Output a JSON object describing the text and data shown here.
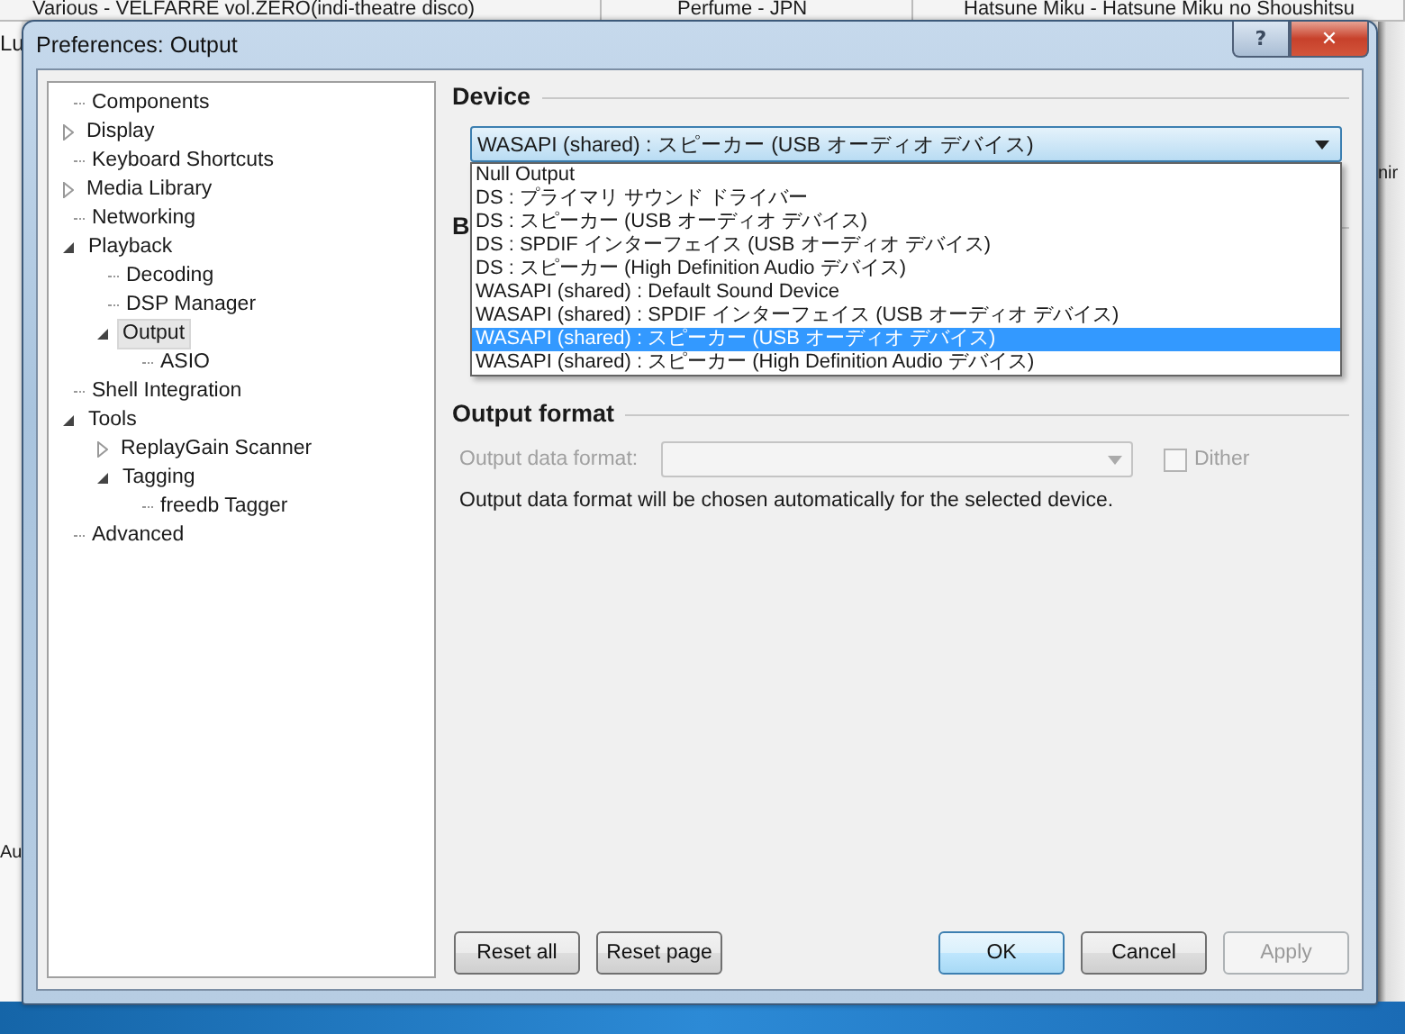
{
  "background_window": {
    "header_cells": [
      "Various - VELFARRE vol.ZERO(indi-theatre disco)",
      "Perfume - JPN",
      "Hatsune Miku - Hatsune Miku no Shoushitsu"
    ],
    "left_fragments": [
      "Lu",
      "Au"
    ],
    "right_fragments": [
      "nir"
    ]
  },
  "window": {
    "title": "Preferences: Output",
    "help_button": "?",
    "close_button": "✕"
  },
  "tree": [
    {
      "label": "Components",
      "kind": "leaf",
      "selected": false
    },
    {
      "label": "Display",
      "kind": "branch",
      "expanded": false,
      "selected": false
    },
    {
      "label": "Keyboard Shortcuts",
      "kind": "leaf",
      "selected": false
    },
    {
      "label": "Media Library",
      "kind": "branch",
      "expanded": false,
      "selected": false
    },
    {
      "label": "Networking",
      "kind": "leaf",
      "selected": false
    },
    {
      "label": "Playback",
      "kind": "branch",
      "expanded": true,
      "selected": false,
      "children": [
        {
          "label": "Decoding",
          "kind": "leaf",
          "selected": false
        },
        {
          "label": "DSP Manager",
          "kind": "leaf",
          "selected": false
        },
        {
          "label": "Output",
          "kind": "branch",
          "expanded": true,
          "selected": true,
          "children": [
            {
              "label": "ASIO",
              "kind": "leaf",
              "selected": false
            }
          ]
        }
      ]
    },
    {
      "label": "Shell Integration",
      "kind": "leaf",
      "selected": false
    },
    {
      "label": "Tools",
      "kind": "branch",
      "expanded": true,
      "selected": false,
      "children": [
        {
          "label": "ReplayGain Scanner",
          "kind": "branch",
          "expanded": false,
          "selected": false
        },
        {
          "label": "Tagging",
          "kind": "branch",
          "expanded": true,
          "selected": false,
          "children": [
            {
              "label": "freedb Tagger",
              "kind": "leaf",
              "selected": false
            }
          ]
        }
      ]
    },
    {
      "label": "Advanced",
      "kind": "leaf",
      "selected": false
    }
  ],
  "device": {
    "heading": "Device",
    "value": "WASAPI (shared) : スピーカー (USB オーディオ デバイス)",
    "expanded": true,
    "options": [
      {
        "label": "Null Output",
        "selected": false
      },
      {
        "label": "DS : プライマリ サウンド ドライバー",
        "selected": false
      },
      {
        "label": "DS : スピーカー (USB オーディオ デバイス)",
        "selected": false
      },
      {
        "label": "DS : SPDIF インターフェイス (USB オーディオ デバイス)",
        "selected": false
      },
      {
        "label": "DS : スピーカー (High Definition Audio デバイス)",
        "selected": false
      },
      {
        "label": "WASAPI (shared) : Default Sound Device",
        "selected": false
      },
      {
        "label": "WASAPI (shared) : SPDIF インターフェイス (USB オーディオ デバイス)",
        "selected": false
      },
      {
        "label": "WASAPI (shared) : スピーカー (USB オーディオ デバイス)",
        "selected": true
      },
      {
        "label": "WASAPI (shared) : スピーカー (High Definition Audio デバイス)",
        "selected": false
      }
    ]
  },
  "hidden_group": {
    "heading": "B"
  },
  "output_format": {
    "heading": "Output format",
    "field_label": "Output data format:",
    "disabled": true,
    "dither": {
      "label": "Dither",
      "checked": false
    },
    "note": "Output data format will be chosen automatically for the selected device."
  },
  "buttons": [
    {
      "label": "Reset all",
      "kind": "reset",
      "focused": false,
      "disabled": false
    },
    {
      "label": "Reset page",
      "kind": "reset",
      "focused": false,
      "disabled": false
    },
    {
      "label": "OK",
      "kind": "commit",
      "focused": true,
      "disabled": false
    },
    {
      "label": "Cancel",
      "kind": "commit",
      "focused": false,
      "disabled": false
    },
    {
      "label": "Apply",
      "kind": "commit",
      "focused": false,
      "disabled": true
    }
  ]
}
